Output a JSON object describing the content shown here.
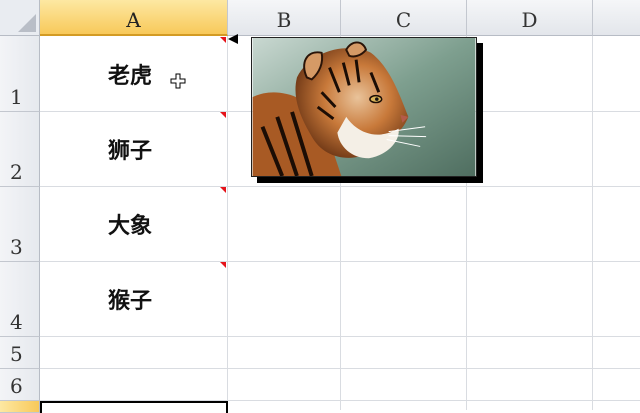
{
  "columns": [
    "A",
    "B",
    "C",
    "D"
  ],
  "rows": [
    "1",
    "2",
    "3",
    "4",
    "5",
    "6"
  ],
  "cells": {
    "a1": "老虎",
    "a2": "狮子",
    "a3": "大象",
    "a4": "猴子"
  },
  "picture": {
    "subject": "tiger-photo"
  },
  "colors": {
    "selected_header": "#f8c95a",
    "grid": "#d9dce1",
    "comment_marker": "#e5141b"
  }
}
